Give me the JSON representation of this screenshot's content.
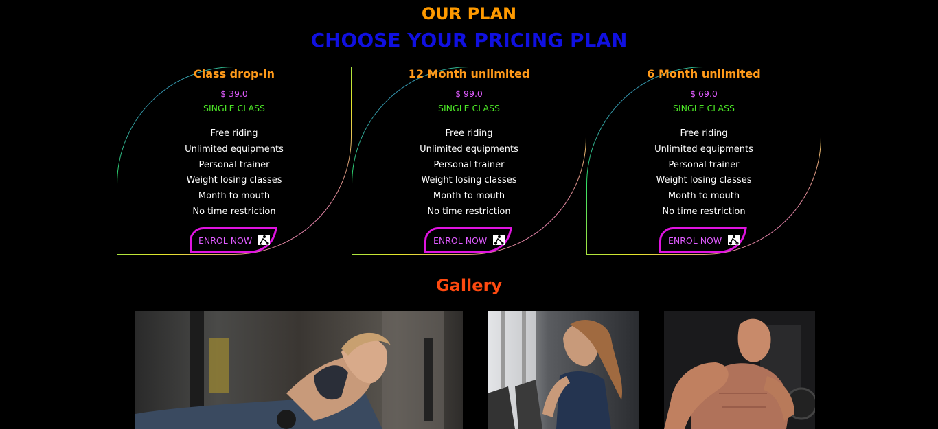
{
  "header": {
    "eyebrow": "OUR PLAN",
    "headline": "CHOOSE YOUR PRICING PLAN"
  },
  "colors": {
    "eyebrow": "#ff9a00",
    "headline": "#1010e0",
    "card_title": "#ff9a1a",
    "price": "#e05cff",
    "plan_type": "#4ce626",
    "feature": "#ffffff",
    "enrol_border": "#e014e0",
    "enrol_text": "#e05cff",
    "gallery_title": "#ff4a10"
  },
  "plans": [
    {
      "name": "Class drop-in",
      "price": "$ 39.0",
      "type": "SINGLE CLASS",
      "features": [
        "Free riding",
        "Unlimited equipments",
        "Personal trainer",
        "Weight losing classes",
        "Month to mouth",
        "No time restriction"
      ],
      "cta": "ENROL NOW",
      "cta_icon": "rider-icon"
    },
    {
      "name": "12 Month unlimited",
      "price": "$ 99.0",
      "type": "SINGLE CLASS",
      "features": [
        "Free riding",
        "Unlimited equipments",
        "Personal trainer",
        "Weight losing classes",
        "Month to mouth",
        "No time restriction"
      ],
      "cta": "ENROL NOW",
      "cta_icon": "rider-icon"
    },
    {
      "name": "6 Month unlimited",
      "price": "$ 69.0",
      "type": "SINGLE CLASS",
      "features": [
        "Free riding",
        "Unlimited equipments",
        "Personal trainer",
        "Weight losing classes",
        "Month to mouth",
        "No time restriction"
      ],
      "cta": "ENROL NOW",
      "cta_icon": "rider-icon"
    }
  ],
  "gallery": {
    "title": "Gallery",
    "images": [
      {
        "subject": "woman doing push-ups on handles in gym"
      },
      {
        "subject": "woman with ponytail on treadmill in gym"
      },
      {
        "subject": "muscular bald man doing bicep curl"
      }
    ]
  }
}
